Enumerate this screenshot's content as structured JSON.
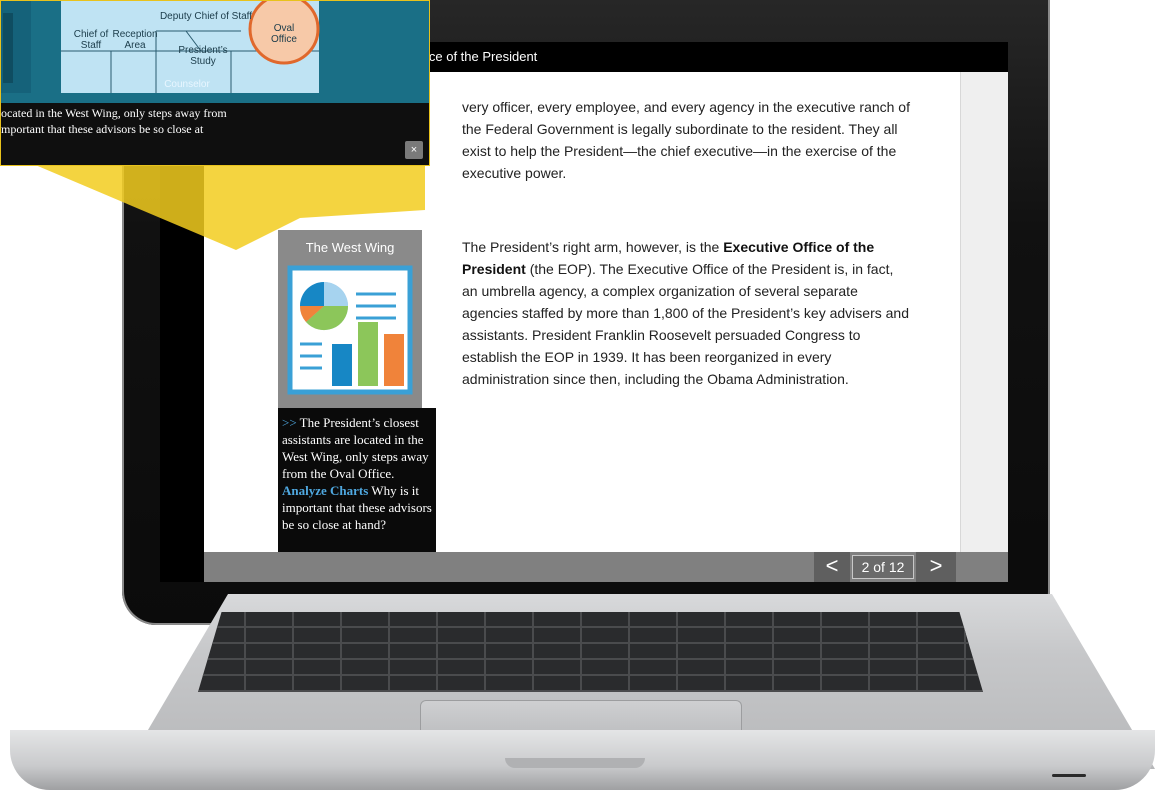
{
  "reader": {
    "title": "ice of the President",
    "paragraph1": "very officer, every employee, and every agency in the executive ranch of the Federal Government is legally subordinate to the resident. They all exist to help the President—the chief executive—in the exercise of the executive power.",
    "paragraph2_intro": "The President’s right arm, however, is the ",
    "paragraph2_bold": "Executive Office of the President",
    "paragraph2_rest": " (the EOP). The Executive Office of the President is, in fact, an umbrella agency, a complex organization of several separate agencies staffed by more than 1,800 of the President’s key advisers and assistants. President Franklin Roosevelt persuaded Congress to establish the EOP in 1939. It has been reorganized in every administration since then, including the Obama Administration."
  },
  "sidebar_card": {
    "title": "The West Wing",
    "icon": "chart-icon",
    "caption_arrows": ">>",
    "caption_text": " The President’s closest assistants are located in the West Wing, only steps away from the Oval Office. ",
    "caption_link": "Analyze Charts",
    "caption_question": " Why is it important that these advisors be so close at hand?"
  },
  "navigation": {
    "prev_label": "<",
    "page_indicator": "2 of 12",
    "next_label": ">"
  },
  "popup": {
    "map_labels": {
      "deputy": "Deputy Chief of Staff",
      "chief": "Chief of Staff",
      "reception": "Reception Area",
      "study": "President’s Study",
      "oval": "Oval Office",
      "counselor": "Counselor"
    },
    "caption_line1": "ocated in the West Wing, only steps away from",
    "caption_line2": "mportant that these advisors be so close at",
    "close_label": "×"
  },
  "colors": {
    "callout_yellow": "#f2cd1f",
    "link_blue": "#4fa8e0",
    "map_blue": "#1a6f86",
    "oval_office": "#f7c9a8"
  }
}
